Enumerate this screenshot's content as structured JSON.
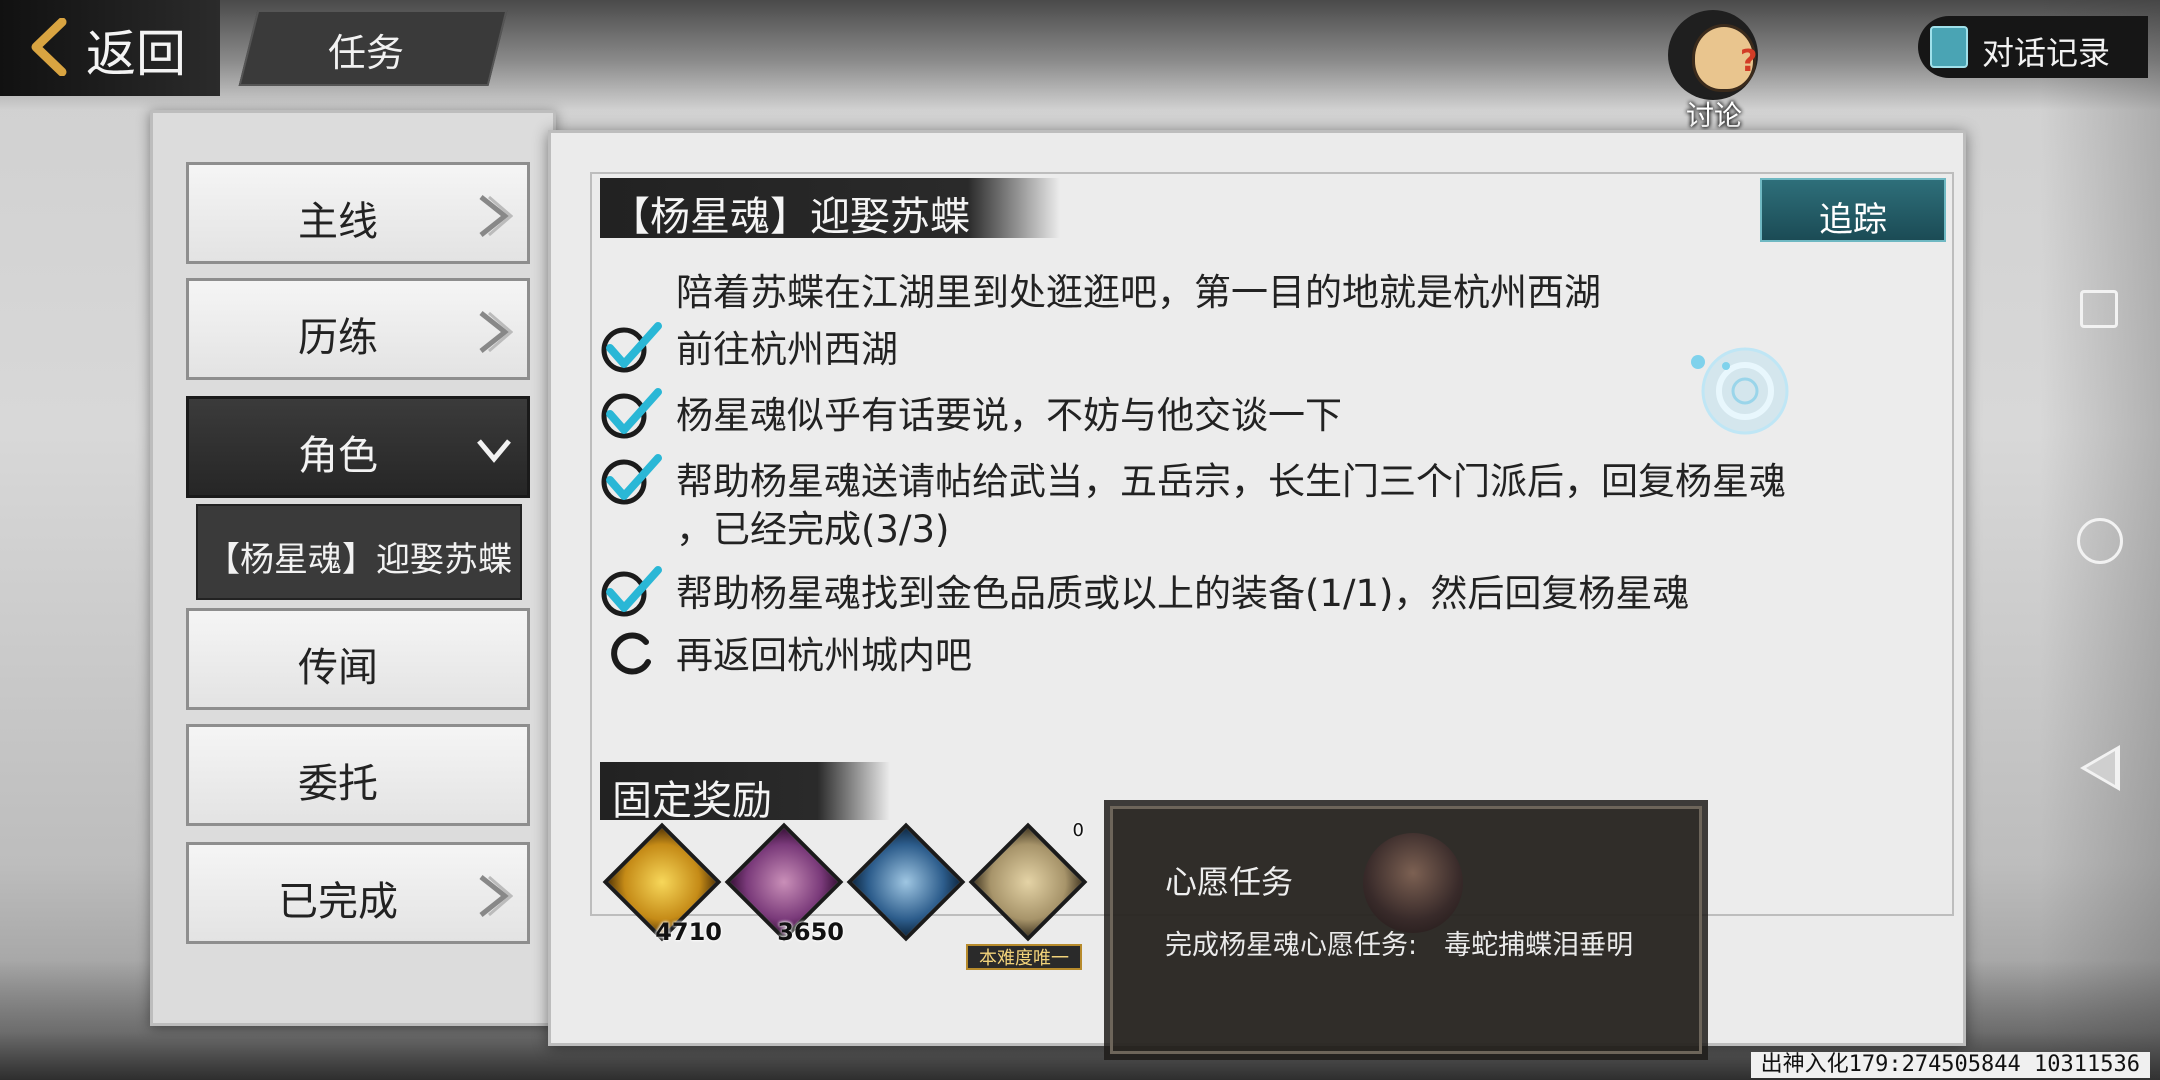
{
  "header": {
    "back_label": "返回",
    "title": "任务",
    "discuss_label": "讨论",
    "dialog_log_label": "对话记录"
  },
  "sidebar": {
    "tabs": [
      {
        "label": "主线",
        "state": "collapsed"
      },
      {
        "label": "历练",
        "state": "collapsed"
      },
      {
        "label": "角色",
        "state": "expanded"
      },
      {
        "label": "传闻",
        "state": "none"
      },
      {
        "label": "委托",
        "state": "none"
      },
      {
        "label": "已完成",
        "state": "collapsed"
      }
    ],
    "sub_item": "【杨星魂】迎娶苏蝶"
  },
  "quest": {
    "title": "【杨星魂】迎娶苏蝶",
    "track_label": "追踪",
    "description": "陪着苏蝶在江湖里到处逛逛吧，第一目的地就是杭州西湖",
    "objectives": [
      {
        "text": "前往杭州西湖",
        "done": true
      },
      {
        "text": "杨星魂似乎有话要说，不妨与他交谈一下",
        "done": true
      },
      {
        "text": "帮助杨星魂送请帖给武当，五岳宗，长生门三个门派后，回复杨星魂",
        "text2": "，已经完成(3/3)",
        "done": true
      },
      {
        "text": "帮助杨星魂找到金色品质或以上的装备(1/1)，然后回复杨星魂",
        "done": true
      },
      {
        "text": "再返回杭州城内吧",
        "done": false
      }
    ]
  },
  "rewards": {
    "title": "固定奖励",
    "items": [
      {
        "icon": "gold-orb-icon",
        "count": "4710"
      },
      {
        "icon": "coin-icon",
        "count": "3650"
      },
      {
        "icon": "book-icon",
        "count": ""
      },
      {
        "icon": "map-scroll-icon",
        "tag": "本难度唯一",
        "count": "0"
      }
    ]
  },
  "tooltip": {
    "title": "心愿任务",
    "body": "完成杨星魂心愿任务:　毒蛇捕蝶泪垂明"
  },
  "status": "出神入化179:274505844 10311536",
  "colors": {
    "accent_teal": "#2e6f7a",
    "check_blue": "#2ab7d6",
    "panel_bg": "#ebebeb"
  }
}
